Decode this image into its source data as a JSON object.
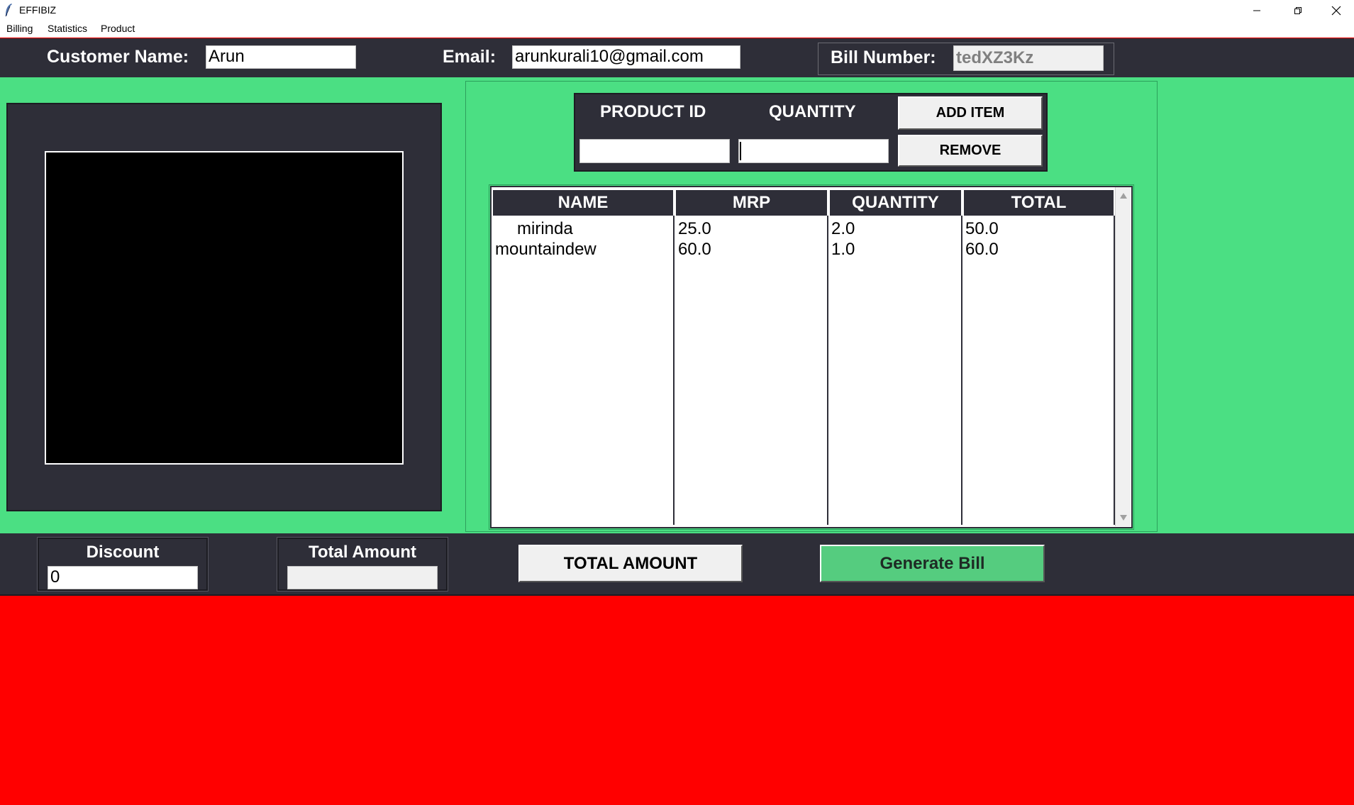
{
  "window": {
    "title": "EFFIBIZ",
    "controls": {
      "minimize": "minimize-icon",
      "restore": "restore-icon",
      "close": "close-icon"
    }
  },
  "menu": [
    "Billing",
    "Statistics",
    "Product"
  ],
  "customer": {
    "name_label": "Customer Name:",
    "name_value": "Arun",
    "email_label": "Email:",
    "email_value": "arunkurali10@gmail.com",
    "bill_label": "Bill Number:",
    "bill_value": "tedXZ3Kz"
  },
  "item_entry": {
    "product_id_label": "PRODUCT ID",
    "quantity_label": "QUANTITY",
    "product_id_value": "",
    "quantity_value": "",
    "add_button": "ADD ITEM",
    "remove_button": "REMOVE"
  },
  "table": {
    "columns": [
      "NAME",
      "MRP",
      "QUANTITY",
      "TOTAL"
    ],
    "rows": [
      {
        "name": "mirinda",
        "mrp": "25.0",
        "quantity": "2.0",
        "total": "50.0"
      },
      {
        "name": "mountaindew",
        "mrp": "60.0",
        "quantity": "1.0",
        "total": "60.0"
      }
    ]
  },
  "footer": {
    "discount_label": "Discount",
    "discount_value": "0",
    "total_label": "Total Amount",
    "total_value": "",
    "total_button": "TOTAL AMOUNT",
    "generate_button": "Generate Bill"
  },
  "colors": {
    "main_green": "#4bdf83",
    "panel_dark": "#2e2e38",
    "bottom_red": "#ff0000",
    "generate_green": "#55cc7f"
  }
}
